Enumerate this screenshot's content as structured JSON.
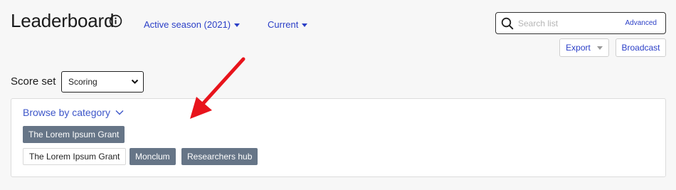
{
  "header": {
    "title": "Leaderboard",
    "info_icon": "info-circle-icon"
  },
  "filters": {
    "season_label": "Active season (2021)",
    "period_label": "Current"
  },
  "search": {
    "placeholder": "Search list",
    "value": "",
    "advanced_label": "Advanced"
  },
  "toolbar": {
    "export_label": "Export",
    "broadcast_label": "Broadcast"
  },
  "score_set": {
    "label": "Score set",
    "selected": "Scoring"
  },
  "browse": {
    "label": "Browse by category",
    "active_tag": "The Lorem Ipsum Grant",
    "tags": [
      "The Lorem Ipsum Grant",
      "Monclum",
      "Researchers hub"
    ]
  },
  "colors": {
    "link": "#2b3fc7",
    "tag_filled": "#667587",
    "annotation_arrow": "#e8141c"
  }
}
